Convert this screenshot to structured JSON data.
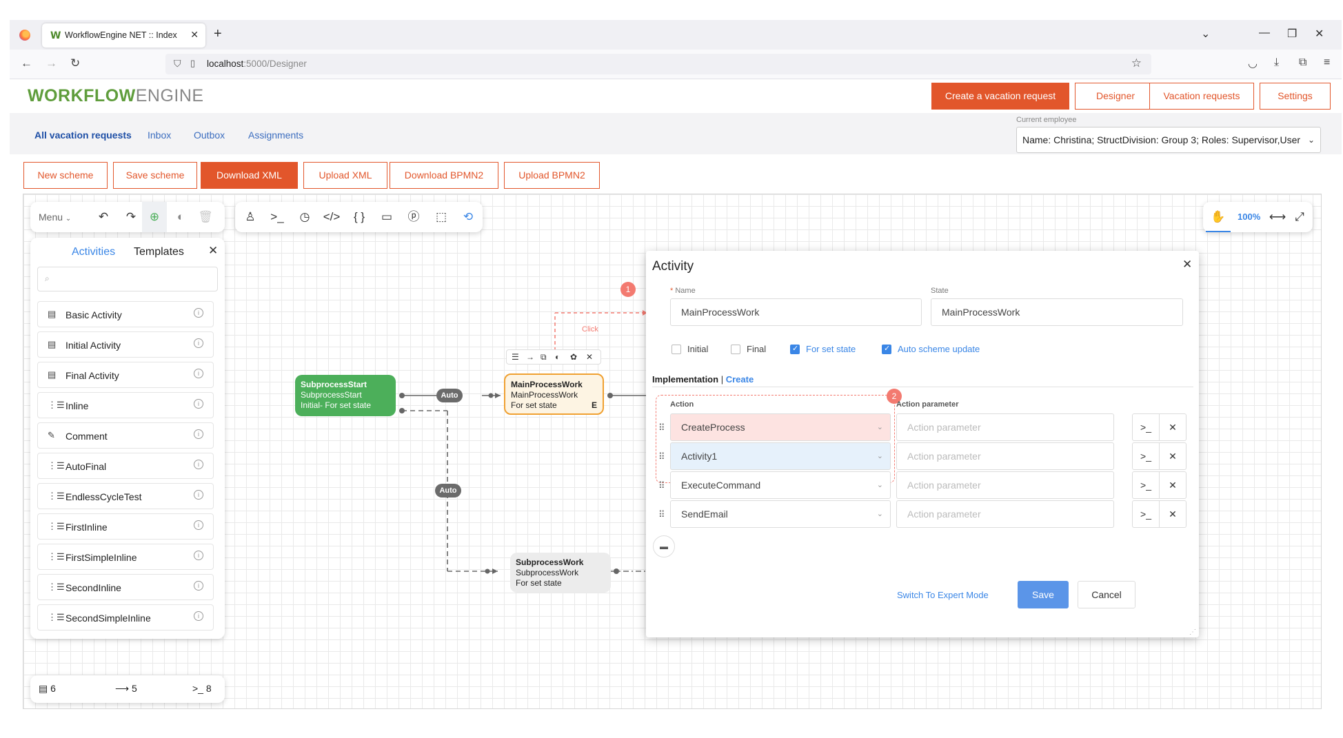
{
  "browser": {
    "tab_title": "WorkflowEngine NET :: Index",
    "url_host": "localhost",
    "url_path": ":5000/Designer"
  },
  "app": {
    "logo_bold": "WORKFLOW",
    "logo_light": "ENGINE",
    "top_buttons": [
      "Create a vacation request",
      "Designer",
      "Vacation requests",
      "Settings"
    ],
    "subnav": [
      "All vacation requests",
      "Inbox",
      "Outbox",
      "Assignments"
    ],
    "employee_label": "Current employee",
    "employee_value": "Name: Christina; StructDivision: Group 3; Roles: Supervisor,User"
  },
  "scheme_buttons": [
    "New scheme",
    "Save scheme",
    "Download XML",
    "Upload XML",
    "Download BPMN2",
    "Upload BPMN2"
  ],
  "toolbar": {
    "menu_label": "Menu",
    "zoom": "100%"
  },
  "sidebar": {
    "tab_activities": "Activities",
    "tab_templates": "Templates",
    "search_placeholder": "",
    "items": [
      {
        "label": "Basic Activity",
        "icon": "activity-icon"
      },
      {
        "label": "Initial Activity",
        "icon": "initial-activity-icon"
      },
      {
        "label": "Final Activity",
        "icon": "final-activity-icon"
      },
      {
        "label": "Inline",
        "icon": "inline-icon"
      },
      {
        "label": "Comment",
        "icon": "comment-icon"
      },
      {
        "label": "AutoFinal",
        "icon": "inline-icon"
      },
      {
        "label": "EndlessCycleTest",
        "icon": "inline-icon"
      },
      {
        "label": "FirstInline",
        "icon": "inline-icon"
      },
      {
        "label": "FirstSimpleInline",
        "icon": "inline-icon"
      },
      {
        "label": "SecondInline",
        "icon": "inline-icon"
      },
      {
        "label": "SecondSimpleInline",
        "icon": "inline-icon"
      }
    ],
    "counts": {
      "activities": "6",
      "transitions": "5",
      "commands": "8"
    }
  },
  "canvas": {
    "node_start": {
      "title": "SubprocessStart",
      "state": "SubprocessStart",
      "sub": "Initial- For set state"
    },
    "node_main": {
      "title": "MainProcessWork",
      "state": "MainProcessWork",
      "sub": "For set state",
      "flag": "E"
    },
    "node_sub": {
      "title": "SubprocessWork",
      "state": "SubprocessWork",
      "sub": "For set state"
    },
    "label_auto": "Auto",
    "label_click": "Click",
    "badge1": "1",
    "badge2": "2"
  },
  "dialog": {
    "title": "Activity",
    "name_label": "Name",
    "name_value": "MainProcessWork",
    "state_label": "State",
    "state_value": "MainProcessWork",
    "checkboxes": [
      {
        "label": "Initial",
        "checked": false
      },
      {
        "label": "Final",
        "checked": false
      },
      {
        "label": "For set state",
        "checked": true
      },
      {
        "label": "Auto scheme update",
        "checked": true
      }
    ],
    "impl_label": "Implementation",
    "impl_link": "Create",
    "action_header": "Action",
    "param_header": "Action parameter",
    "param_placeholder": "Action parameter",
    "actions": [
      "CreateProcess",
      "Activity1",
      "ExecuteCommand",
      "SendEmail"
    ],
    "expert_mode": "Switch To Expert Mode",
    "save": "Save",
    "cancel": "Cancel"
  },
  "colors": {
    "brand_orange": "#e2562b",
    "brand_green": "#5f9d3c",
    "node_green": "#4caf5a",
    "node_orange": "#f0a030",
    "highlight_red": "#f37a70",
    "link_blue": "#3a86e6"
  }
}
